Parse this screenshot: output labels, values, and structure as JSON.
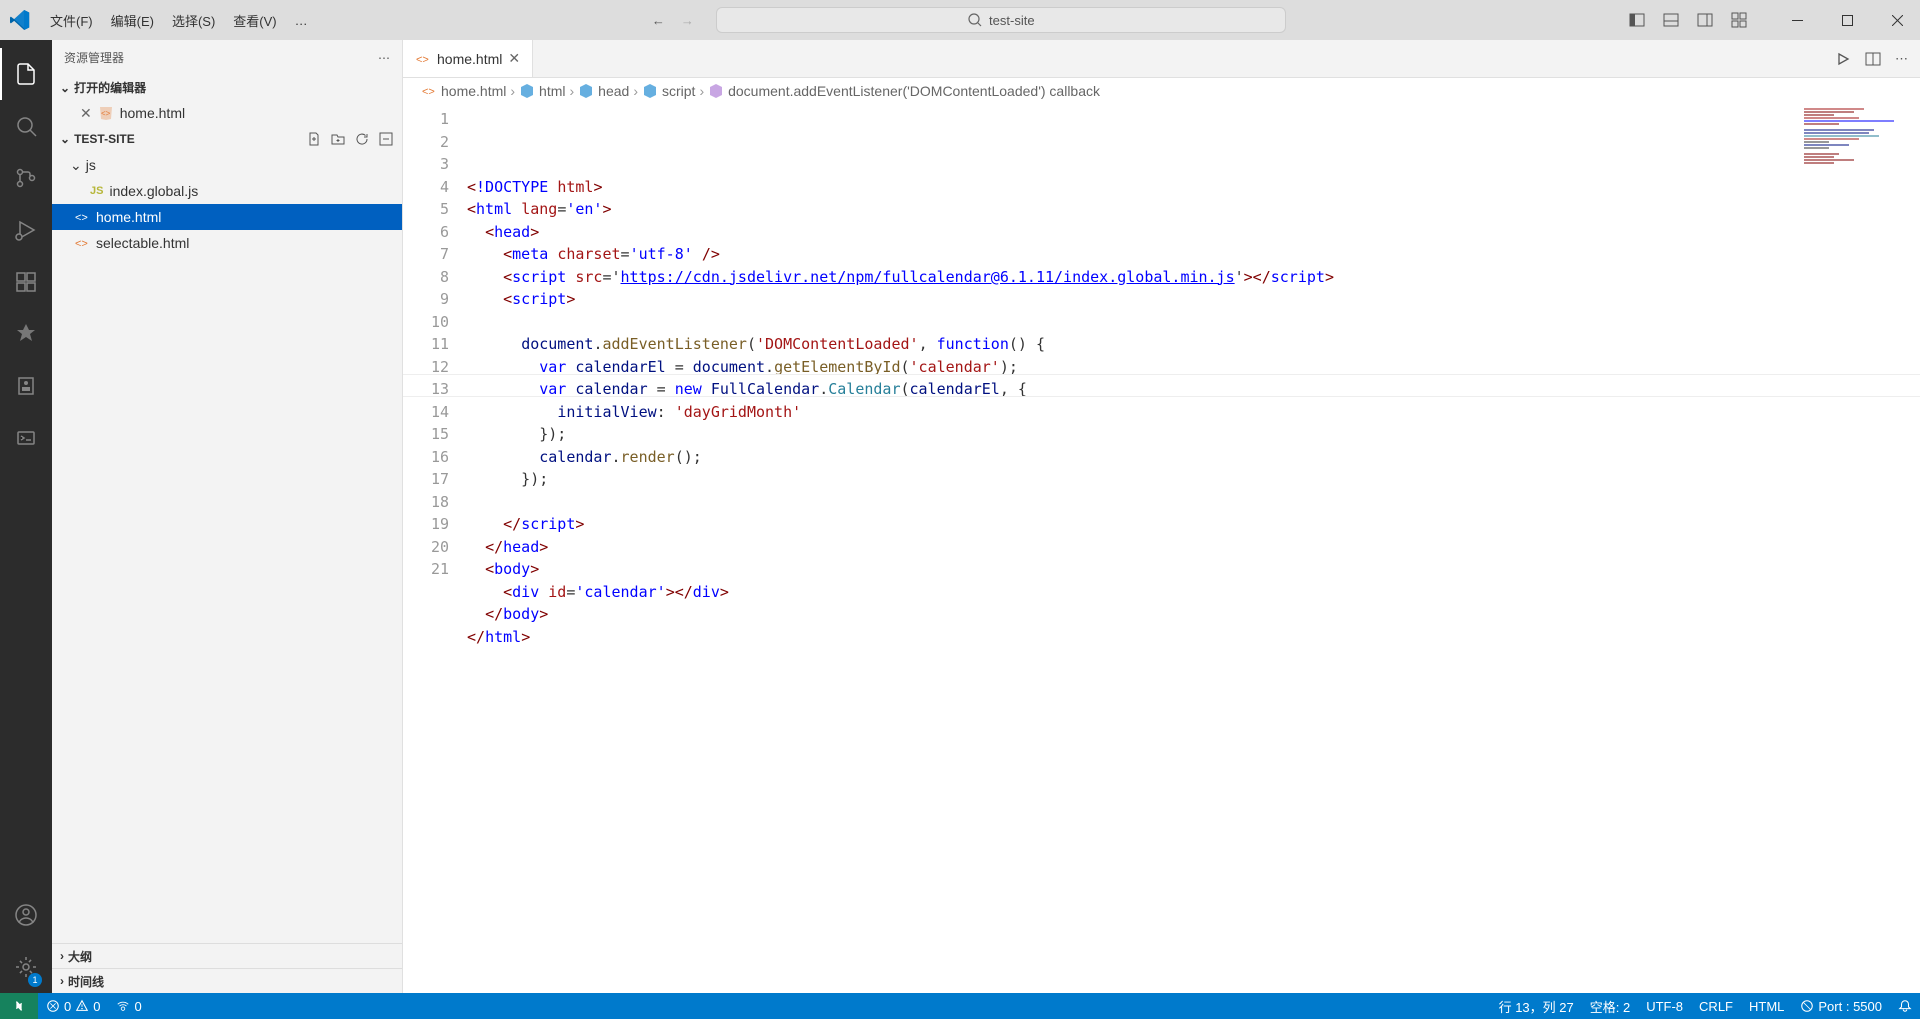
{
  "menu": {
    "file": "文件(F)",
    "edit": "编辑(E)",
    "select": "选择(S)",
    "view": "查看(V)",
    "more": "…"
  },
  "search_placeholder": "test-site",
  "sidebar": {
    "title": "资源管理器",
    "open_editors": "打开的编辑器",
    "project": "TEST-SITE",
    "outline": "大纲",
    "timeline": "时间线"
  },
  "open_editors": [
    {
      "name": "home.html"
    }
  ],
  "tree": {
    "folder_js": "js",
    "file_index": "index.global.js",
    "file_home": "home.html",
    "file_selectable": "selectable.html"
  },
  "tab": {
    "name": "home.html"
  },
  "breadcrumbs": {
    "b1": "home.html",
    "b2": "html",
    "b3": "head",
    "b4": "script",
    "b5": "document.addEventListener('DOMContentLoaded') callback"
  },
  "code": {
    "l1": {
      "doctype": "!DOCTYPE",
      "html": "html"
    },
    "l2": {
      "tag": "html",
      "attr": "lang",
      "val": "'en'"
    },
    "l3": {
      "tag": "head"
    },
    "l4": {
      "tag": "meta",
      "attr": "charset",
      "val": "'utf-8'"
    },
    "l5": {
      "tag": "script",
      "attr": "src",
      "url": "https://cdn.jsdelivr.net/npm/fullcalendar@6.1.11/index.global.min.js"
    },
    "l6": {
      "tag": "script"
    },
    "l8": {
      "obj": "document",
      "fn": "addEventListener",
      "arg": "'DOMContentLoaded'",
      "kw": "function"
    },
    "l9": {
      "kw": "var",
      "name": "calendarEl",
      "obj": "document",
      "fn": "getElementById",
      "arg": "'calendar'"
    },
    "l10": {
      "kw": "var",
      "name": "calendar",
      "new": "new",
      "cls": "FullCalendar",
      "ctor": "Calendar",
      "arg": "calendarEl"
    },
    "l11": {
      "prop": "initialView",
      "val": "'dayGridMonth'"
    },
    "l13": {
      "obj": "calendar",
      "fn": "render"
    },
    "l16": {
      "tag": "script"
    },
    "l17": {
      "tag": "head"
    },
    "l18": {
      "tag": "body"
    },
    "l19": {
      "tag": "div",
      "attr": "id",
      "val": "'calendar'"
    },
    "l20": {
      "tag": "body"
    },
    "l21": {
      "tag": "html"
    }
  },
  "line_numbers": [
    "1",
    "2",
    "3",
    "4",
    "5",
    "6",
    "7",
    "8",
    "9",
    "10",
    "11",
    "12",
    "13",
    "14",
    "15",
    "16",
    "17",
    "18",
    "19",
    "20",
    "21"
  ],
  "status": {
    "errors": "0",
    "warnings": "0",
    "ports": "0",
    "ln_col": "行 13，列 27",
    "spaces": "空格: 2",
    "encoding": "UTF-8",
    "eol": "CRLF",
    "lang": "HTML",
    "port": "Port : 5500"
  }
}
